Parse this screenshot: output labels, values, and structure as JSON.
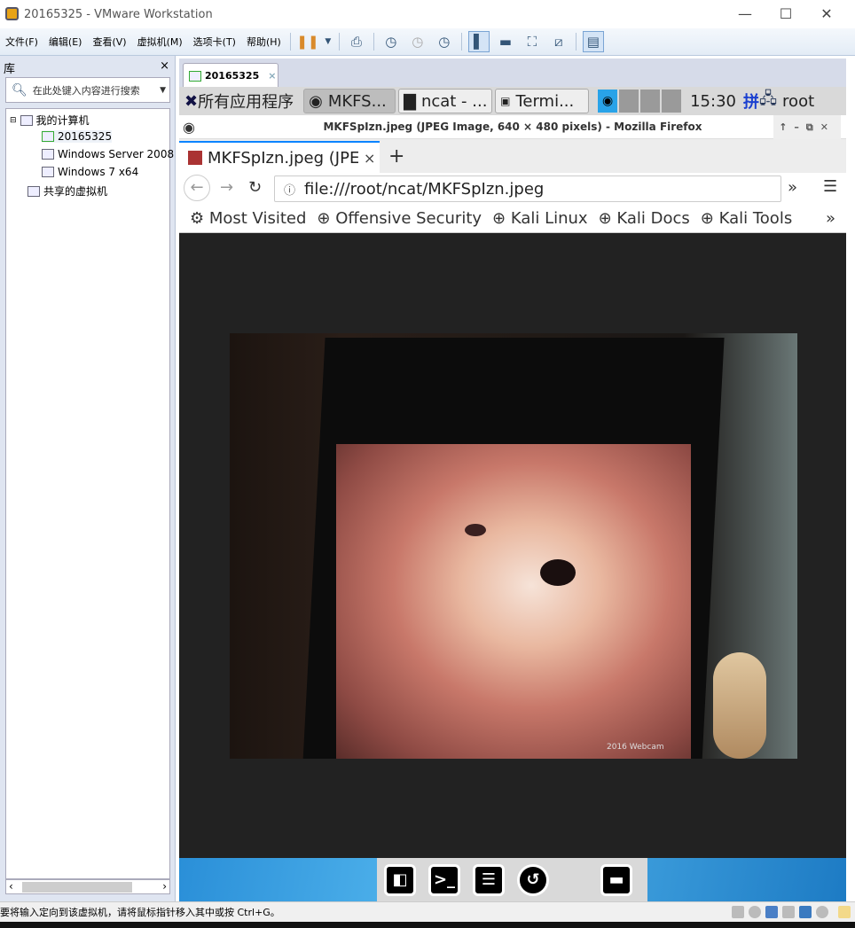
{
  "window": {
    "title": "20165325 - VMware Workstation",
    "min": "—",
    "max": "☐",
    "close": "✕"
  },
  "menu": [
    "文件(F)",
    "编辑(E)",
    "查看(V)",
    "虚拟机(M)",
    "选项卡(T)",
    "帮助(H)"
  ],
  "library": {
    "title": "库",
    "close": "×",
    "search_placeholder": "在此处键入内容进行搜索",
    "tree": {
      "root": "我的计算机",
      "vms": [
        "20165325",
        "Windows Server 2008",
        "Windows 7 x64"
      ],
      "shared": "共享的虚拟机"
    }
  },
  "vm_tab": {
    "label": "20165325",
    "close": "×"
  },
  "kali_panel": {
    "apps": "所有应用程序",
    "tasks": [
      "MKFS...",
      "ncat - ...",
      "Termi..."
    ],
    "clock": "15:30",
    "ime": "拼",
    "user": "root"
  },
  "firefox": {
    "title": "MKFSpIzn.jpeg (JPEG Image, 640 × 480 pixels) - Mozilla Firefox",
    "tab": "MKFSpIzn.jpeg (JPEG Image",
    "new_tab": "+",
    "url": "file:///root/ncat/MKFSpIzn.jpeg",
    "bookmarks": [
      "Most Visited",
      "Offensive Security",
      "Kali Linux",
      "Kali Docs",
      "Kali Tools"
    ],
    "overflow": "»",
    "menu": "☰"
  },
  "image": {
    "caption": "2016 Webcam"
  },
  "status": {
    "text": "要将输入定向到该虚拟机，请将鼠标指针移入其中或按 Ctrl+G。"
  }
}
